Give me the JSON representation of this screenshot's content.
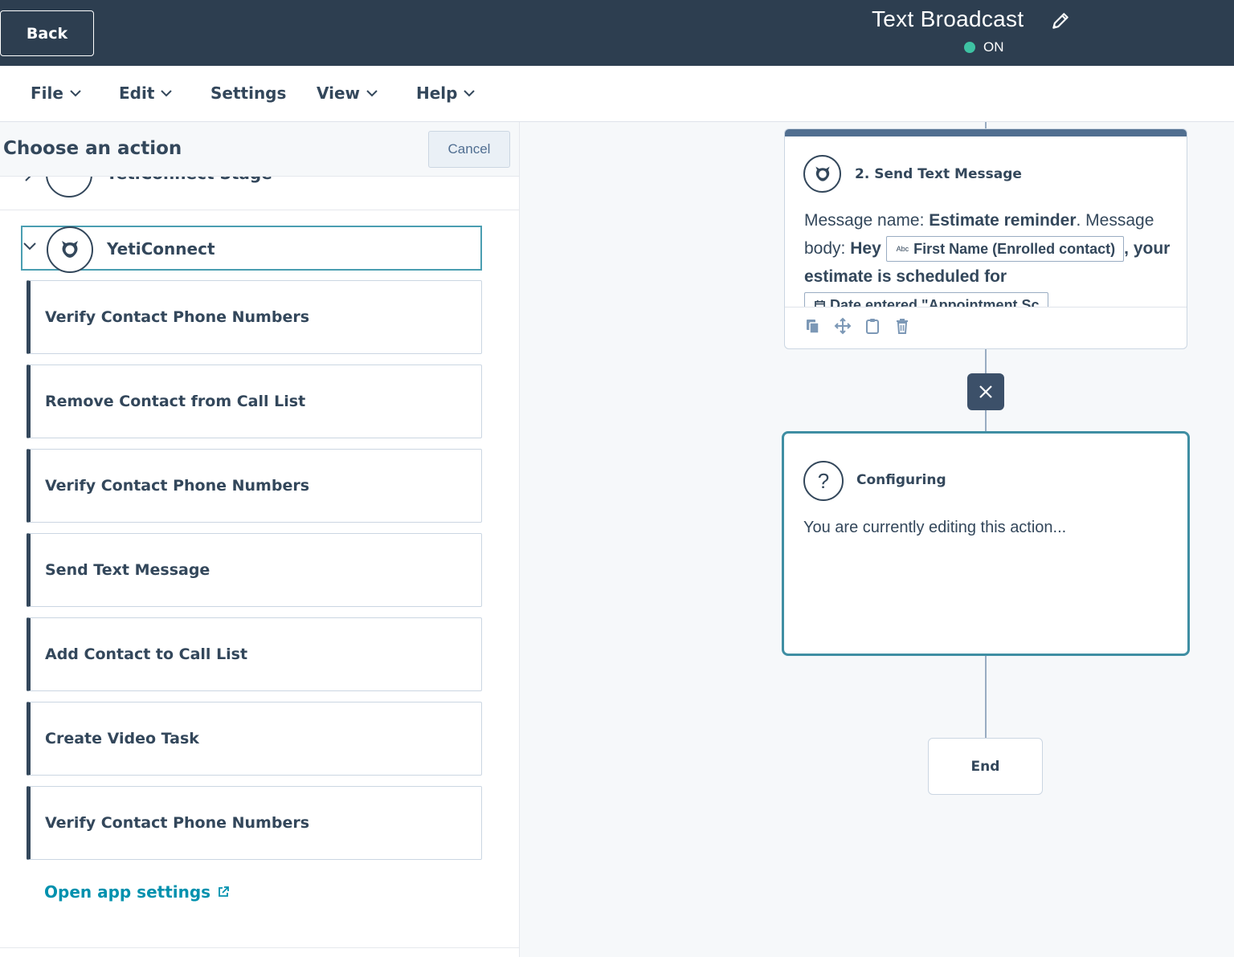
{
  "header": {
    "back_label": "Back",
    "title": "Text Broadcast",
    "status": "ON",
    "status_color": "#3ec2a3",
    "background": "#2d3e50"
  },
  "menu": {
    "items": [
      {
        "label": "File",
        "icon": "chevron-down-icon"
      },
      {
        "label": "Edit",
        "icon": "chevron-down-icon"
      },
      {
        "label": "Settings"
      },
      {
        "label": "View",
        "icon": "chevron-down-icon"
      },
      {
        "label": "Help",
        "icon": "chevron-down-icon"
      }
    ]
  },
  "panel": {
    "title": "Choose an action",
    "cancel_label": "Cancel",
    "previous_group_label": "YetiConnect Stage",
    "group": {
      "label": "YetiConnect",
      "icon": "yeti-logo-icon",
      "actions": [
        {
          "label": "Verify Contact Phone Numbers"
        },
        {
          "label": "Remove Contact from Call List"
        },
        {
          "label": "Verify Contact Phone Numbers"
        },
        {
          "label": "Send Text Message"
        },
        {
          "label": "Add Contact to Call List"
        },
        {
          "label": "Create Video Task"
        },
        {
          "label": "Verify Contact Phone Numbers"
        }
      ]
    },
    "app_settings_label": "Open app settings",
    "accent_color": "#0091ae"
  },
  "canvas": {
    "step_card": {
      "title": "2. Send Text Message",
      "body": {
        "prefix_label": "Message name: ",
        "message_name": "Estimate reminder",
        "after_name": ". Message body: ",
        "hey": "Hey",
        "token_first_name_type": "Abc",
        "token_first_name": "First Name (Enrolled contact)",
        "comma": ",",
        "text_after": "your estimate is scheduled for",
        "token_date": "Date entered \"Appointment Sc"
      },
      "tools": [
        "copy-icon",
        "move-icon",
        "clipboard-icon",
        "trash-icon"
      ]
    },
    "configuring_card": {
      "title": "Configuring",
      "text": "You are currently editing this action...",
      "border_color": "#3f8ea3"
    },
    "end_label": "End"
  }
}
